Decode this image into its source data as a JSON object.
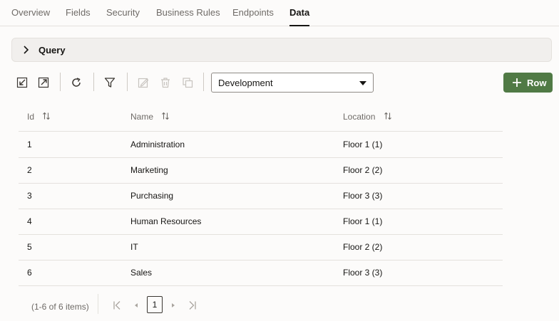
{
  "tabs": [
    {
      "label": "Overview"
    },
    {
      "label": "Fields"
    },
    {
      "label": "Security"
    },
    {
      "label": "Business Rules"
    },
    {
      "label": "Endpoints"
    },
    {
      "label": "Data",
      "active": true
    }
  ],
  "query": {
    "label": "Query"
  },
  "toolbar": {
    "icons": [
      "import-icon",
      "export-icon",
      "refresh-icon",
      "filter-icon",
      "edit-icon",
      "delete-icon",
      "duplicate-icon"
    ],
    "environment_select": {
      "value": "Development"
    },
    "add_row_label": "Row"
  },
  "table": {
    "columns": [
      "Id",
      "Name",
      "Location"
    ],
    "rows": [
      {
        "id": "1",
        "name": "Administration",
        "location": "Floor 1 (1)"
      },
      {
        "id": "2",
        "name": "Marketing",
        "location": "Floor 2 (2)"
      },
      {
        "id": "3",
        "name": "Purchasing",
        "location": "Floor 3 (3)"
      },
      {
        "id": "4",
        "name": "Human Resources",
        "location": "Floor 1 (1)"
      },
      {
        "id": "5",
        "name": "IT",
        "location": "Floor 2 (2)"
      },
      {
        "id": "6",
        "name": "Sales",
        "location": "Floor 3 (3)"
      }
    ]
  },
  "pagination": {
    "summary": "(1-6 of 6 items)",
    "current_page": "1"
  },
  "colors": {
    "primary_button": "#507a45",
    "text": "#161513",
    "muted": "#6f6b67"
  }
}
